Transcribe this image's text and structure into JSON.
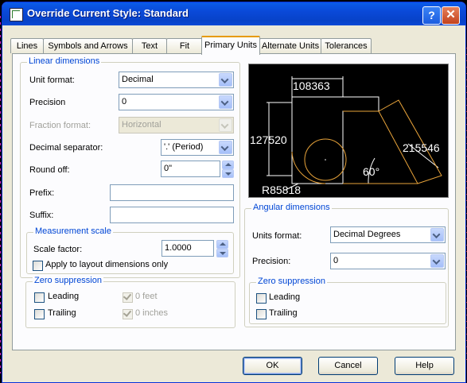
{
  "dialog": {
    "title": "Override Current Style: Standard",
    "help_glyph": "?",
    "close_glyph": "✕"
  },
  "tabs": [
    {
      "label": "Lines"
    },
    {
      "label": "Symbols and Arrows"
    },
    {
      "label": "Text"
    },
    {
      "label": "Fit"
    },
    {
      "label": "Primary Units",
      "active": true
    },
    {
      "label": "Alternate Units"
    },
    {
      "label": "Tolerances"
    }
  ],
  "linear": {
    "group_title": "Linear dimensions",
    "unit_format_label": "Unit format:",
    "unit_format_value": "Decimal",
    "precision_label": "Precision",
    "precision_value": "0",
    "fraction_format_label": "Fraction format:",
    "fraction_format_value": "Horizontal",
    "decimal_separator_label": "Decimal separator:",
    "decimal_separator_value": "'.' (Period)",
    "round_off_label": "Round off:",
    "round_off_value": "0\"",
    "prefix_label": "Prefix:",
    "prefix_value": "",
    "suffix_label": "Suffix:",
    "suffix_value": ""
  },
  "measurement": {
    "group_title": "Measurement scale",
    "scale_factor_label": "Scale factor:",
    "scale_factor_value": "1.0000",
    "apply_layout_label": "Apply to layout dimensions only"
  },
  "zero_linear": {
    "group_title": "Zero suppression",
    "leading_label": "Leading",
    "trailing_label": "Trailing",
    "feet_label": "0 feet",
    "inches_label": "0 inches"
  },
  "preview": {
    "dim_top": "108363",
    "dim_left": "127520",
    "dim_right": "215546",
    "dim_angle": "60°",
    "dim_radius": "R85818"
  },
  "angular": {
    "group_title": "Angular dimensions",
    "units_format_label": "Units format:",
    "units_format_value": "Decimal Degrees",
    "precision_label": "Precision:",
    "precision_value": "0"
  },
  "zero_angular": {
    "group_title": "Zero suppression",
    "leading_label": "Leading",
    "trailing_label": "Trailing"
  },
  "buttons": {
    "ok": "OK",
    "cancel": "Cancel",
    "help": "Help"
  },
  "colors": {
    "accent": "#0046d5",
    "titlebar": "#0a5ce9",
    "preview_geometry": "#ffffff",
    "preview_dimension": "#e8a33a"
  }
}
